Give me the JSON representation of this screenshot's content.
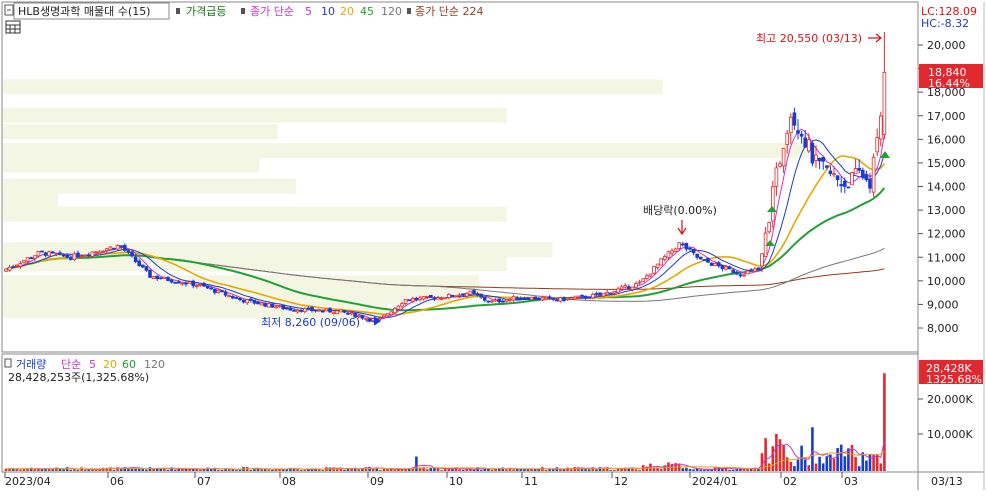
{
  "header": {
    "stock": "HLB생명과학 매물대 수(15)",
    "surge_label": "가격급등",
    "ma_label": "종가 단순",
    "ma_periods": [
      "5",
      "10",
      "20",
      "45",
      "120"
    ],
    "ma_long_label": "종가 단순 224",
    "lc": "LC:128.09",
    "hc": "HC:-8.32"
  },
  "colors": {
    "up": "#e0282e",
    "down": "#1a3ccc",
    "ma5": "#cc33cc",
    "ma10": "#1a3ccc",
    "ma20": "#e6a800",
    "ma45": "#22a033",
    "ma120": "#777777",
    "ma224": "#9a3a1a",
    "volume_profile": "#f3f6e2"
  },
  "annotations": {
    "high": "최고 20,550 (03/13)",
    "low": "최저 8,260 (09/06)",
    "dividend": "배당락(0.00%)"
  },
  "price_axis": {
    "ticks": [
      "20,000",
      "19,000",
      "18,000",
      "17,000",
      "16,000",
      "15,000",
      "14,000",
      "13,000",
      "12,000",
      "11,000",
      "10,000",
      "9,000",
      "8,000"
    ],
    "current": "18,840",
    "change": "16.44%"
  },
  "volume_panel": {
    "title": "거래량",
    "ma_label": "단순",
    "ma_periods": [
      "5",
      "20",
      "60",
      "120"
    ],
    "value_text": "28,428,253주(1,325.68%)",
    "ticks": [
      "20,000K",
      "10,000K"
    ],
    "current": "28,428K",
    "change": "1325.68%"
  },
  "x_axis": {
    "labels": [
      "2023/04",
      "06",
      "07",
      "08",
      "09",
      "10",
      "11",
      "12",
      "2024/01",
      "02",
      "03"
    ],
    "right_label": "03/13"
  },
  "chart_data": {
    "type": "candlestick",
    "title": "HLB생명과학",
    "period": "2023/04 - 2024/03/13",
    "price_ylim": [
      7500,
      20800
    ],
    "volume_ylim": [
      0,
      28500000
    ],
    "price_path": [
      {
        "month": "2023/04",
        "close": 10500
      },
      {
        "month": "2023/05",
        "close": 11300
      },
      {
        "month": "2023/06",
        "close": 10200
      },
      {
        "month": "2023/07",
        "close": 9800
      },
      {
        "month": "2023/08",
        "close": 8700
      },
      {
        "month": "2023/09",
        "close": 8700
      },
      {
        "month": "2023/10",
        "close": 9300
      },
      {
        "month": "2023/11",
        "close": 9200
      },
      {
        "month": "2023/12",
        "close": 9900
      },
      {
        "month": "2024/01",
        "close": 10400
      },
      {
        "month": "2024/02",
        "close": 14500
      },
      {
        "month": "2024/03",
        "close": 18840
      }
    ],
    "high": {
      "value": 20550,
      "date": "03/13"
    },
    "low": {
      "value": 8260,
      "date": "09/06"
    },
    "last": {
      "close": 18840,
      "change_pct": 16.44,
      "volume": 28428253,
      "volume_change_pct": 1325.68
    },
    "volume_profile": [
      {
        "price": 18200,
        "relative": 0.72
      },
      {
        "price": 17000,
        "relative": 0.55
      },
      {
        "price": 16300,
        "relative": 0.3
      },
      {
        "price": 15500,
        "relative": 0.88
      },
      {
        "price": 14900,
        "relative": 0.28
      },
      {
        "price": 14000,
        "relative": 0.32
      },
      {
        "price": 13400,
        "relative": 0.06
      },
      {
        "price": 12800,
        "relative": 0.55
      },
      {
        "price": 11300,
        "relative": 0.6
      },
      {
        "price": 10700,
        "relative": 0.55
      },
      {
        "price": 9900,
        "relative": 0.52
      },
      {
        "price": 9300,
        "relative": 0.5
      },
      {
        "price": 8700,
        "relative": 0.42
      }
    ],
    "series": [
      {
        "name": "5",
        "color": "#cc33cc"
      },
      {
        "name": "10",
        "color": "#1a3ccc"
      },
      {
        "name": "20",
        "color": "#e6a800"
      },
      {
        "name": "45",
        "color": "#22a033"
      },
      {
        "name": "120",
        "color": "#777777"
      },
      {
        "name": "224",
        "color": "#9a3a1a"
      }
    ]
  }
}
